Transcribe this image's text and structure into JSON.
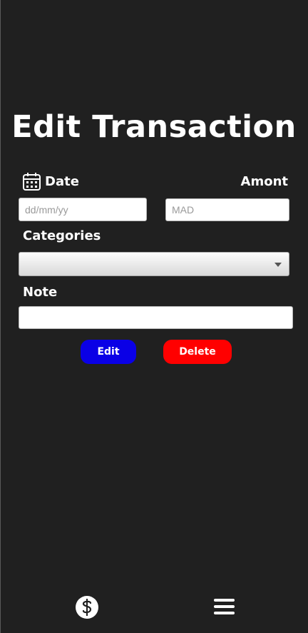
{
  "title": "Edit Transaction",
  "form": {
    "date_label": "Date",
    "date_placeholder": "dd/mm/yy",
    "amount_label": "Amont",
    "amount_placeholder": "MAD",
    "categories_label": "Categories",
    "category_value": "",
    "note_label": "Note",
    "note_value": ""
  },
  "actions": {
    "edit_label": "Edit",
    "delete_label": "Delete"
  },
  "bottom_nav": {
    "items": [
      {
        "icon": "dollar-icon"
      },
      {
        "icon": "menu-icon"
      }
    ]
  },
  "colors": {
    "background": "#202020",
    "edit_button": "#0a00e6",
    "delete_button": "#ff0000"
  }
}
